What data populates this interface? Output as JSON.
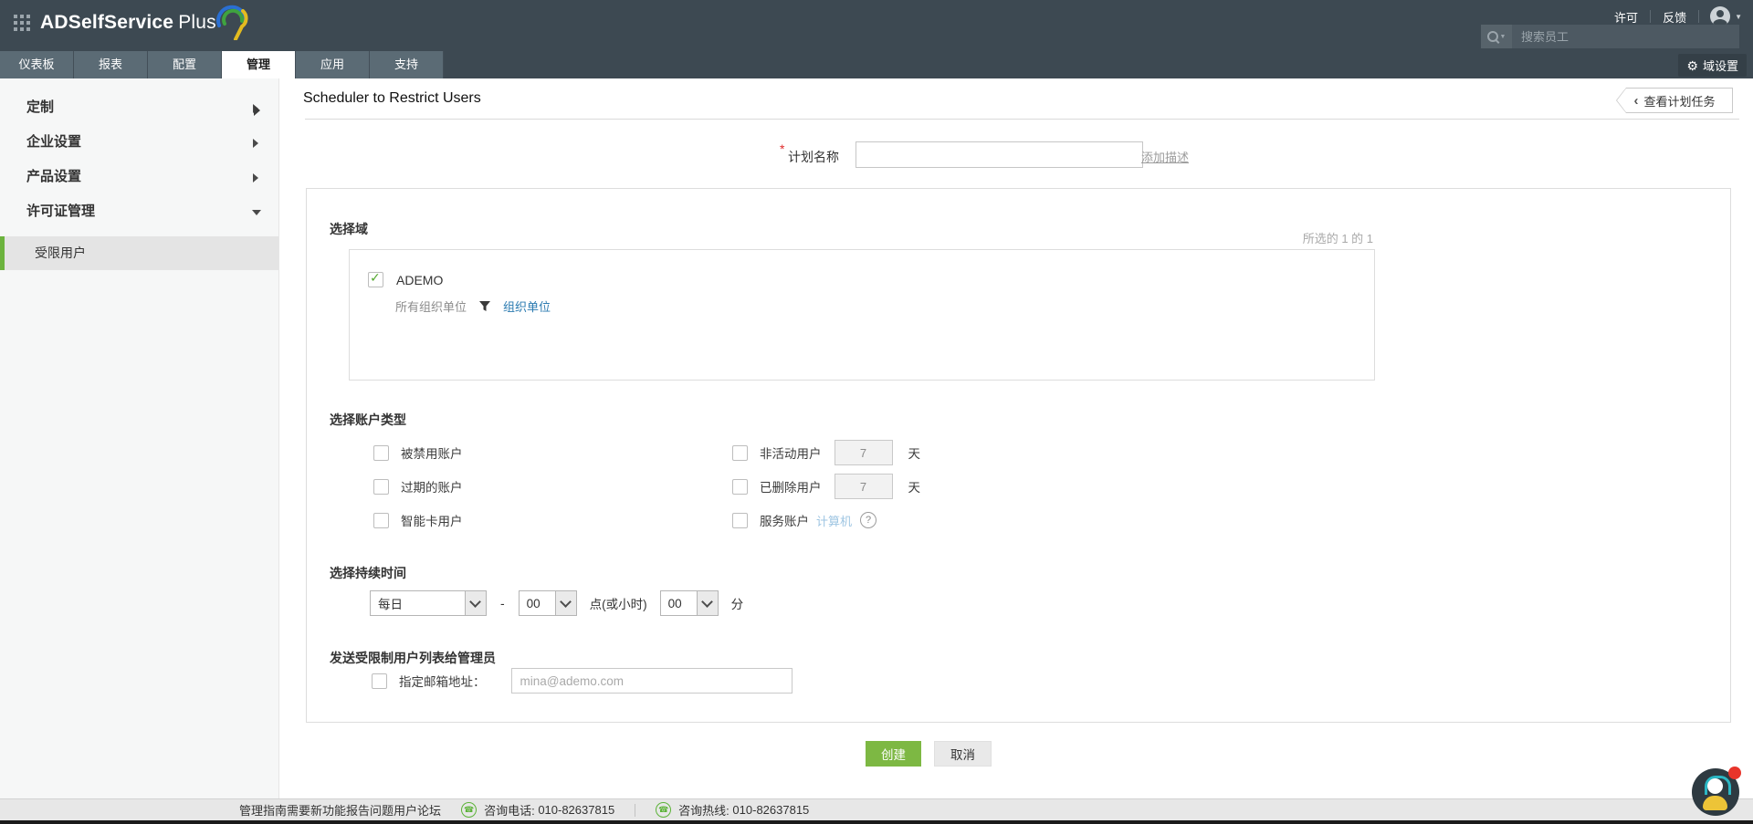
{
  "app": {
    "brand": "ADSelfService",
    "brand_suffix": "Plus"
  },
  "topbar": {
    "links": [
      {
        "label": "许可"
      },
      {
        "label": "反馈"
      }
    ],
    "search_placeholder": "搜索员工"
  },
  "tabs": [
    {
      "label": "仪表板",
      "active": false
    },
    {
      "label": "报表",
      "active": false
    },
    {
      "label": "配置",
      "active": false
    },
    {
      "label": "管理",
      "active": true
    },
    {
      "label": "应用",
      "active": false
    },
    {
      "label": "支持",
      "active": false
    }
  ],
  "domain_settings_label": "域设置",
  "sidebar": {
    "items": [
      {
        "label": "定制",
        "state": "collapsed"
      },
      {
        "label": "企业设置",
        "state": "collapsed"
      },
      {
        "label": "产品设置",
        "state": "collapsed"
      },
      {
        "label": "许可证管理",
        "state": "expanded"
      }
    ],
    "active_subitem": "受限用户"
  },
  "page": {
    "title": "Scheduler to Restrict Users",
    "view_schedules_button": "查看计划任务"
  },
  "form": {
    "name": {
      "required_mark": "*",
      "label": "计划名称",
      "value": "",
      "add_description_link": "添加描述"
    },
    "domain_section": {
      "heading": "选择域",
      "selection_summary": "所选的 1 的 1",
      "domain_name": "ADEMO",
      "checked": true,
      "ou_label": "所有组织单位",
      "ou_link": "组织单位"
    },
    "account_section": {
      "heading": "选择账户类型",
      "left_options": [
        {
          "label": "被禁用账户",
          "checked": false
        },
        {
          "label": "过期的账户",
          "checked": false
        },
        {
          "label": "智能卡用户",
          "checked": false
        }
      ],
      "right_options": [
        {
          "label": "非活动用户",
          "checked": false,
          "days": "7",
          "unit": "天"
        },
        {
          "label": "已删除用户",
          "checked": false,
          "days": "7",
          "unit": "天"
        },
        {
          "label": "服务账户",
          "checked": false,
          "link": "计算机",
          "help": "?"
        }
      ]
    },
    "duration_section": {
      "heading": "选择持续时间",
      "frequency": "每日",
      "dash": "-",
      "hour": "00",
      "hour_suffix": "点(或小时)",
      "minute": "00",
      "minute_suffix": "分"
    },
    "email_section": {
      "heading": "发送受限制用户列表给管理员",
      "checkbox_label": "指定邮箱地址：",
      "email_placeholder": "mina@ademo.com"
    },
    "actions": {
      "create": "创建",
      "cancel": "取消"
    }
  },
  "footer": {
    "links": [
      "管理指南",
      "需要新功能",
      "报告问题",
      "用户论坛"
    ],
    "phone_label": "咨询电话:",
    "phone_number": "010-82637815",
    "hotline_label": "咨询热线:",
    "hotline_number": "010-82637815"
  },
  "icons": {
    "gear": "⚙",
    "phone": "☎",
    "back_chevron": "‹",
    "check": "✓",
    "help": "?",
    "caret_down": "▼",
    "search_caret": "▼"
  },
  "colors": {
    "header_bg": "#3d4952",
    "tab_inactive_bg": "#5b6b75",
    "accent_green": "#7db843",
    "selected_green_bar": "#6cb33e",
    "link_blue": "#2a7ab0",
    "light_link_blue": "#9ec5e2",
    "required_red": "#e02b2b",
    "notification_red": "#e8342a"
  }
}
